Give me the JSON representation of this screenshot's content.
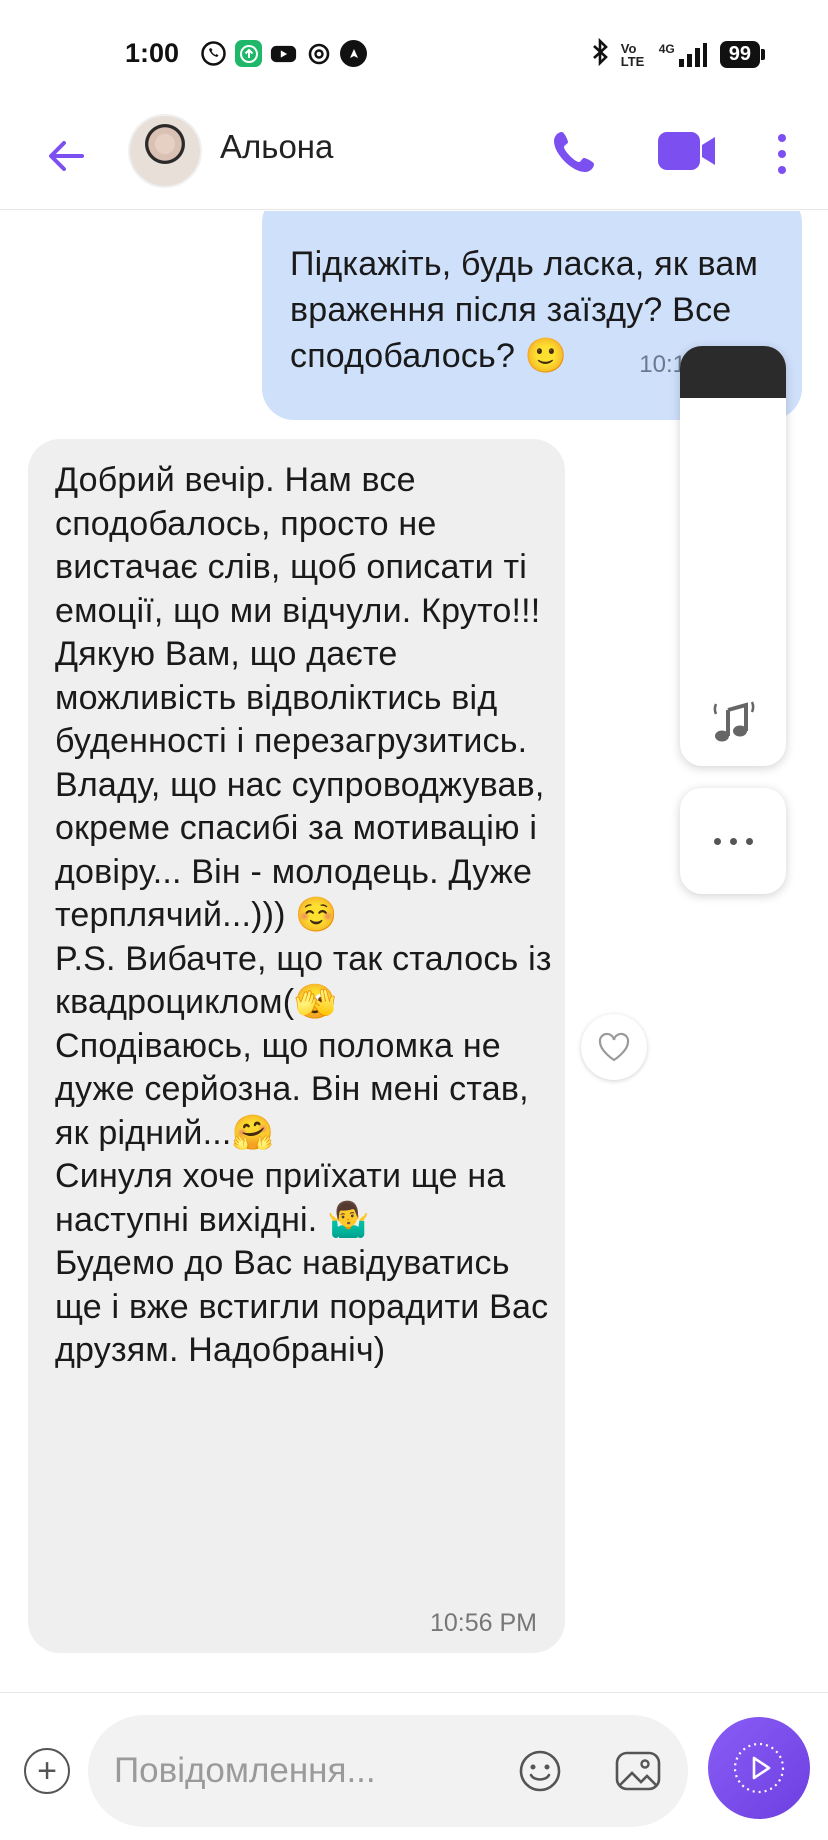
{
  "status_bar": {
    "time": "1:00",
    "app_icons": [
      "viber-icon",
      "upload-icon",
      "youtube-icon",
      "threads-icon",
      "navigation-icon"
    ],
    "bluetooth_icon": "bluetooth-icon",
    "volte_label": "Vo LTE",
    "network_label": "4G",
    "battery_level": "99"
  },
  "header": {
    "back_icon": "back-arrow-icon",
    "contact_name": "Альона",
    "call_icon": "phone-icon",
    "video_icon": "video-camera-icon",
    "more_icon": "more-vertical-icon"
  },
  "messages": {
    "outgoing": {
      "text": "Підкажіть, будь ласка, як вам враження після заїзду? Все сподобалось? 🙂",
      "time": "10:13 PM",
      "status": "✓✓"
    },
    "incoming": {
      "text": "Добрий вечір. Нам все сподобалось, просто не вистачає слів, щоб описати ті емоції, що ми відчули. Круто!!! Дякую Вам, що даєте можливість відволіктись від буденності і перезагрузитись. Владу, що нас супроводжував, окреме спасибі за мотивацію і довіру... Він - молодець. Дуже терплячий...))) ☺️\nP.S. Вибачте, що так сталось із квадроциклом(🫣\nСподіваюсь, що поломка не дуже серйозна. Він мені став, як рідний...🤗\nСинуля хоче приїхати ще на наступні вихідні. 🤷‍♂️\nБудемо до Вас навідуватись ще і вже встигли порадити Вас друзям. Надобраніч)",
      "time": "10:56 PM"
    }
  },
  "side_panel": {
    "music_icon": "music-note-icon",
    "more_icon": "more-horizontal-icon"
  },
  "input": {
    "placeholder": "Повідомлення...",
    "add_icon": "plus-circle-icon",
    "emoji_icon": "emoji-icon",
    "gallery_icon": "gallery-icon",
    "send_icon": "send-play-icon"
  },
  "colors": {
    "accent": "#7b4ff0",
    "outgoing_bubble": "#cfe0fb",
    "incoming_bubble": "#efefef"
  }
}
